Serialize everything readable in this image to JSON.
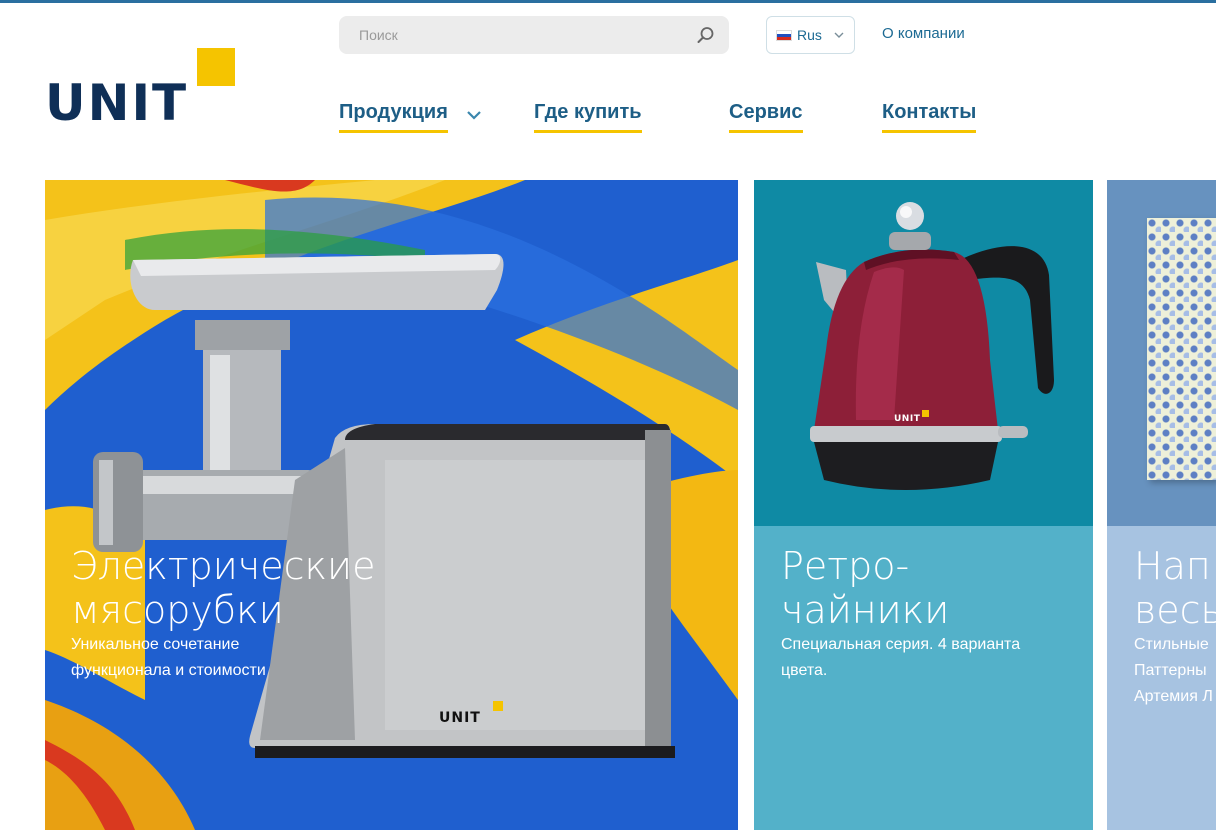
{
  "brand": {
    "logo_text": "UNIT",
    "accent_color": "#f5c400",
    "primary_color": "#0f2f57",
    "link_color": "#1d5e86"
  },
  "search": {
    "placeholder": "Поиск",
    "icon": "search-icon"
  },
  "language": {
    "selected": "Rus",
    "flag_icon": "russia-flag-icon"
  },
  "top_links": {
    "about": "О компании"
  },
  "nav": {
    "items": [
      {
        "label": "Продукция",
        "has_dropdown": true
      },
      {
        "label": "Где купить"
      },
      {
        "label": "Сервис"
      },
      {
        "label": "Контакты"
      }
    ]
  },
  "cards": [
    {
      "title_line1": "Электрические",
      "title_line2": "мясорубки",
      "desc_line1": "Уникальное сочетание",
      "desc_line2": "функционала и стоимости",
      "product_logo": "UNIT",
      "color": "#1f5fcf"
    },
    {
      "title_line1": "Ретро-",
      "title_line2": "чайники",
      "desc_line1": "Специальная серия. 4 варианта",
      "desc_line2": "цвета.",
      "product_logo": "UNIT",
      "color": "#53b1c9"
    },
    {
      "title_line1": "Нап",
      "title_line2": "весь",
      "desc_line1": "Стильные",
      "desc_line2": "Паттерны",
      "desc_line3": "Артемия Л",
      "color": "#a7c3e1"
    }
  ]
}
